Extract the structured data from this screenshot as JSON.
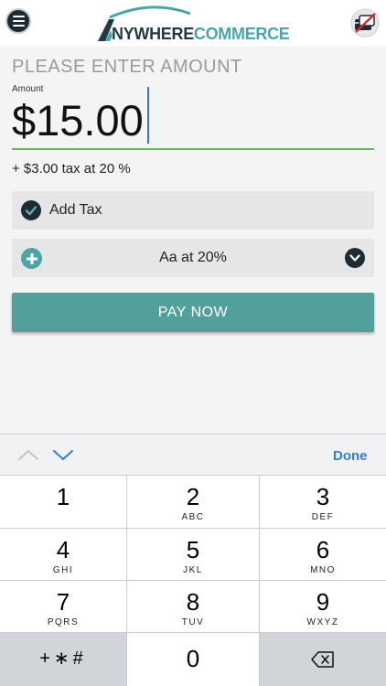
{
  "header": {
    "logo_part1": "NYWHERE",
    "logo_part2": "COMMERCE",
    "menu_icon": "hamburger-menu-icon",
    "reader_icon": "card-reader-disconnected-icon"
  },
  "amount": {
    "prompt": "PLEASE ENTER AMOUNT",
    "label": "Amount",
    "value": "$15.00",
    "tax_note": "+ $3.00 tax at 20 %"
  },
  "tax_toggle": {
    "label": "Add Tax",
    "checked": true
  },
  "tax_rate": {
    "selected": "Aa at 20%"
  },
  "pay_button": {
    "label": "PAY NOW"
  },
  "accessory": {
    "done_label": "Done"
  },
  "keypad": {
    "keys": [
      {
        "num": "1",
        "letters": ""
      },
      {
        "num": "2",
        "letters": "ABC"
      },
      {
        "num": "3",
        "letters": "DEF"
      },
      {
        "num": "4",
        "letters": "GHI"
      },
      {
        "num": "5",
        "letters": "JKL"
      },
      {
        "num": "6",
        "letters": "MNO"
      },
      {
        "num": "7",
        "letters": "PQRS"
      },
      {
        "num": "8",
        "letters": "TUV"
      },
      {
        "num": "9",
        "letters": "WXYZ"
      }
    ],
    "symbols": "+∗#",
    "zero": "0"
  },
  "colors": {
    "brand_teal": "#52a09b",
    "underline_green": "#5cb85c",
    "done_blue": "#2f7fd6",
    "dark_navy": "#1f2b33"
  }
}
